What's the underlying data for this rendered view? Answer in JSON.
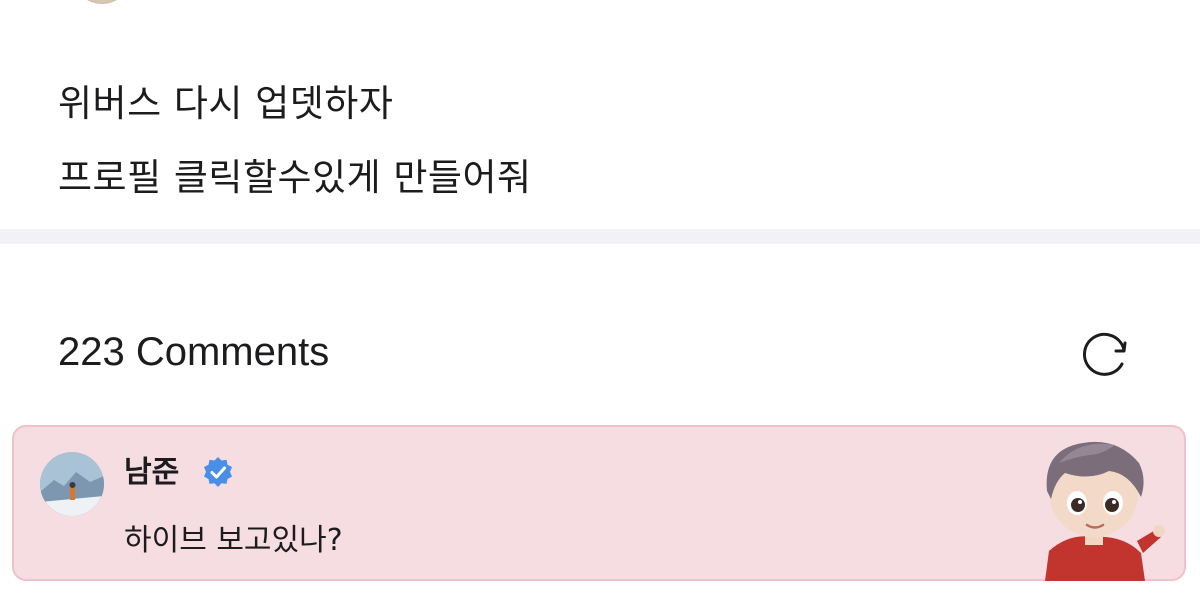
{
  "post": {
    "lines": [
      "위버스 다시 업뎃하자",
      "프로필 클릭할수있게 만들어줘"
    ]
  },
  "comments": {
    "header": "223 Comments",
    "refresh_icon": "refresh-icon",
    "items": [
      {
        "author": "남준",
        "verified": true,
        "verified_color": "#4a8fe7",
        "text": "하이브 보고있나?",
        "highlight_color": "#f6dde2",
        "sticker_icon": "character-sticker"
      }
    ]
  }
}
